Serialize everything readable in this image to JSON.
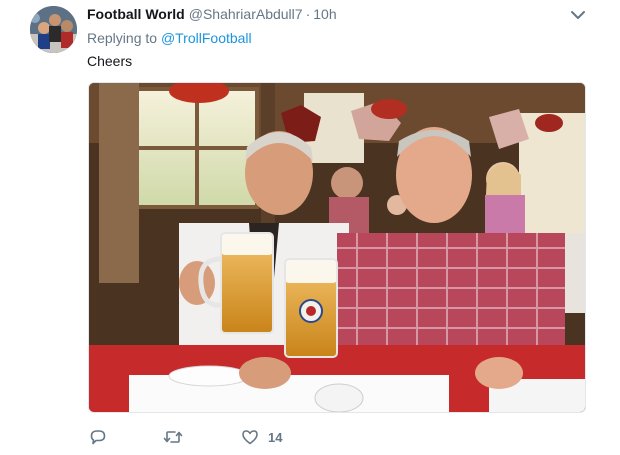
{
  "tweet": {
    "display_name": "Football World",
    "handle": "@ShahriarAbdull7",
    "separator": "·",
    "time": "10h",
    "replying_prefix": "Replying to",
    "replying_to": "@TrollFootball",
    "text": "Cheers",
    "media_icon": "photo-two-men-beer-mugs",
    "actions": {
      "reply_icon": "speech-bubble-icon",
      "retweet_icon": "retweet-arrows-icon",
      "like_icon": "heart-icon",
      "like_count": "14"
    },
    "menu_icon": "chevron-down-icon"
  },
  "colors": {
    "link": "#1b95e0",
    "muted": "#657786",
    "text": "#14171a"
  }
}
